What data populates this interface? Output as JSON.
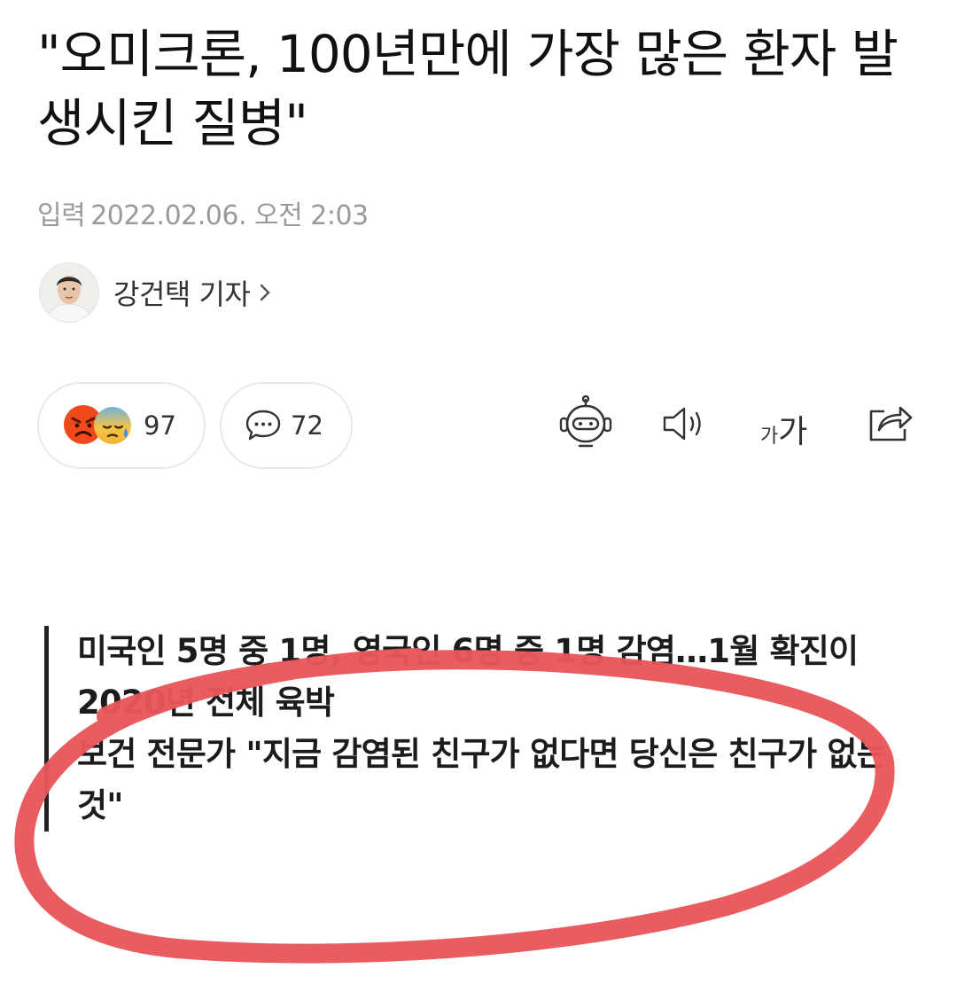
{
  "article": {
    "headline": "\"오미크론, 100년만에 가장 많은 환자 발생시킨 질병\"",
    "date_label": "입력",
    "date_value": "2022.02.06. 오전 2:03",
    "reporter": "강건택 기자"
  },
  "toolbar": {
    "reaction_count": "97",
    "comment_count": "72",
    "font_small": "가",
    "font_big": "가"
  },
  "summary": {
    "lines": [
      "미국인 5명 중 1명, 영국인 6명 중 1명 감염…1월 확진이 2020년 전체 육박",
      "보건 전문가 \"지금 감염된 친구가 없다면 당신은 친구가 없는 것\""
    ]
  },
  "icons": {
    "reaction_1": "angry-face-icon",
    "reaction_2": "sad-sweat-face-icon",
    "comment": "speech-bubble-icon",
    "robot": "robot-summary-icon",
    "speaker": "speaker-icon",
    "share": "share-icon",
    "chevron": "chevron-right-icon"
  },
  "colors": {
    "annotation_red": "#e8555a",
    "date_gray": "#9a9a9a"
  }
}
